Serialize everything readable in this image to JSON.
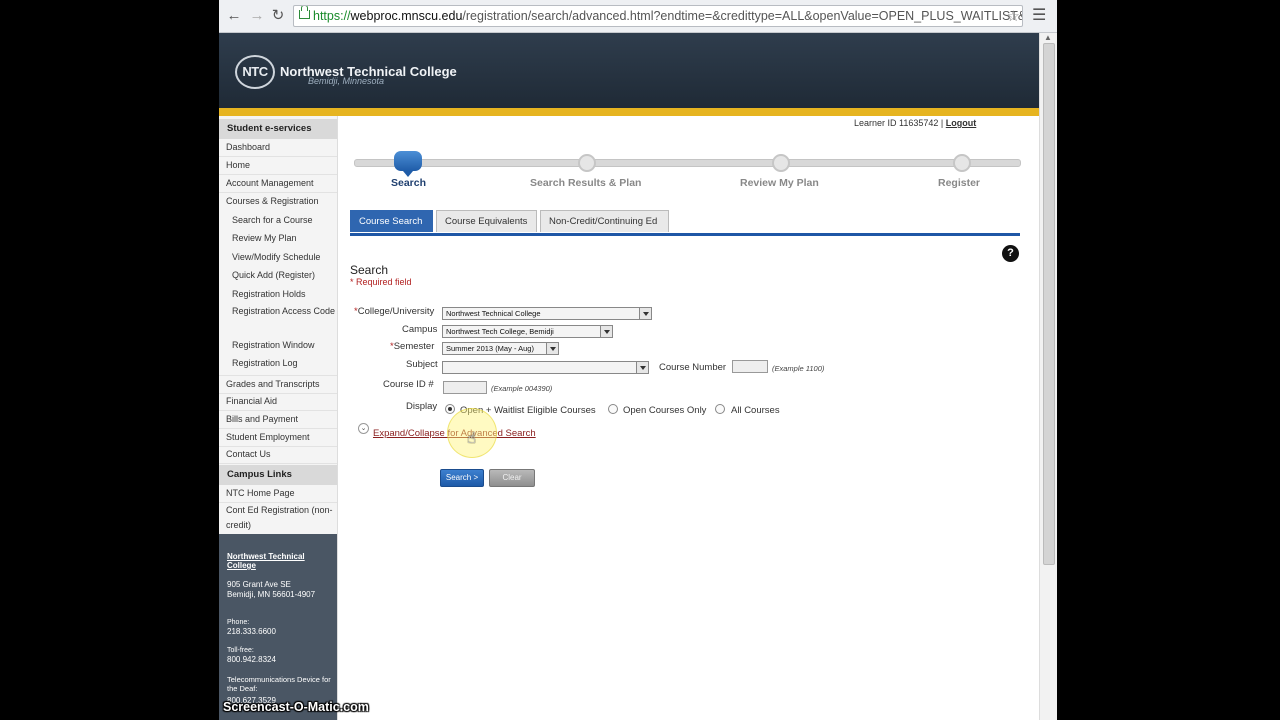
{
  "browser": {
    "url_scheme": "https://",
    "url_host": "webproc.mnscu.edu",
    "url_path": "/registration/search/advanced.html?endtime=&credittype=ALL&openValue=OPEN_PLUS_WAITLIST&resultNu",
    "back_icon": "←",
    "forward_icon": "→",
    "reload_icon": "↻",
    "star_icon": "☆",
    "menu_icon": "☰"
  },
  "header": {
    "logo_abbrev": "NTC",
    "college_name": "Northwest Technical College",
    "city": "Bemidji, Minnesota"
  },
  "sidebar": {
    "heading": "Student e-services",
    "items": [
      "Dashboard",
      "Home",
      "Account Management",
      "Courses & Registration"
    ],
    "sub_items": [
      "Search for a Course",
      "Review My Plan",
      "View/Modify Schedule",
      "Quick Add (Register)",
      "Registration Holds",
      "Registration Access Code",
      "Registration Window",
      "Registration Log"
    ],
    "items2": [
      "Grades and Transcripts",
      "Financial Aid",
      "Bills and Payment",
      "Student Employment",
      "Contact Us"
    ],
    "campus_heading": "Campus Links",
    "campus_items": [
      "NTC Home Page",
      "Cont Ed Registration (non-credit)"
    ],
    "footer": {
      "college": "Northwest Technical College",
      "address1": "905 Grant Ave SE",
      "address2": "Bemidji, MN 56601-4907",
      "phone_label": "Phone:",
      "phone": "218.333.6600",
      "tollfree_label": "Toll-free:",
      "tollfree": "800.942.8324",
      "tdd_label": "Telecommunications Device for the Deaf:",
      "tdd": "800.627.3529"
    }
  },
  "account": {
    "learner_id": "Learner ID 11635742",
    "separator": "|",
    "logout": "Logout"
  },
  "steps": [
    "Search",
    "Search Results & Plan",
    "Review My Plan",
    "Register"
  ],
  "tabs": [
    "Course Search",
    "Course Equivalents",
    "Non-Credit/Continuing Ed"
  ],
  "form": {
    "title": "Search",
    "required_note": "* Required field",
    "asterisk": "*",
    "college_label": "College/University",
    "college_value": "Northwest Technical College",
    "campus_label": "Campus",
    "campus_value": "Northwest Tech College, Bemidji",
    "semester_label": "Semester",
    "semester_value": "Summer 2013 (May - Aug)",
    "subject_label": "Subject",
    "subject_value": "",
    "course_number_label": "Course Number",
    "course_number_example": "(Example 1100)",
    "course_id_label": "Course ID #",
    "course_id_example": "(Example 004390)",
    "display_label": "Display",
    "display_options": [
      "Open + Waitlist Eligible Courses",
      "Open Courses Only",
      "All Courses"
    ],
    "display_selected": "Open + Waitlist Eligible Courses",
    "expand_icon": "⌄",
    "expand_link": "Expand/Collapse for Advanced Search",
    "search_button": "Search >",
    "clear_button": "Clear"
  },
  "help_icon": "?",
  "cursor_icon": "☝",
  "watermark": "Screencast-O-Matic.com"
}
